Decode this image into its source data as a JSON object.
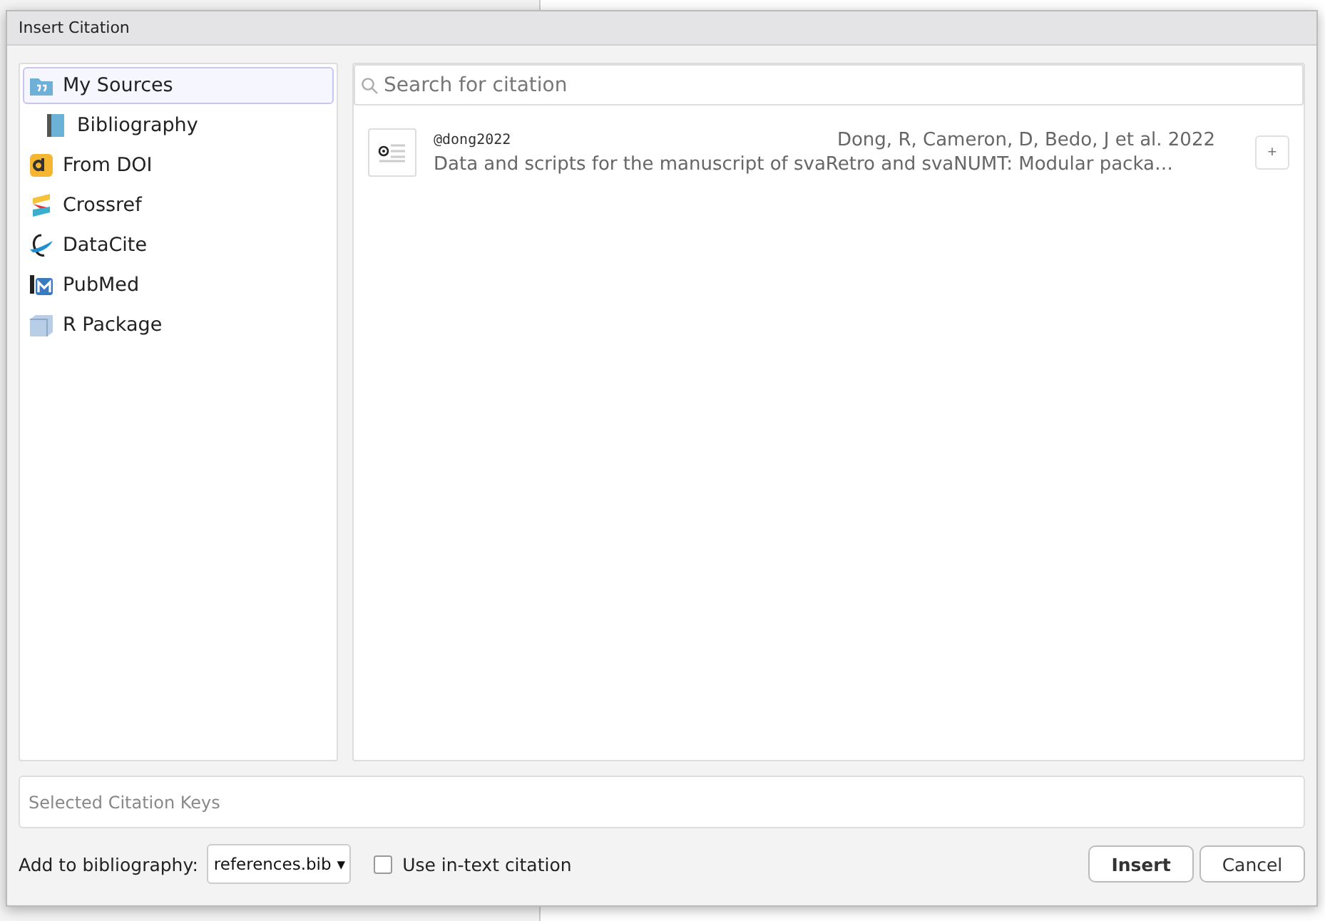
{
  "dialog": {
    "title": "Insert Citation",
    "sources": [
      {
        "label": "My Sources",
        "kind": "folder",
        "selected": true,
        "children": [
          {
            "label": "Bibliography",
            "kind": "book",
            "selected": false
          }
        ]
      },
      {
        "label": "From DOI",
        "kind": "doi",
        "selected": false
      },
      {
        "label": "Crossref",
        "kind": "crossref",
        "selected": false
      },
      {
        "label": "DataCite",
        "kind": "datacite",
        "selected": false
      },
      {
        "label": "PubMed",
        "kind": "pubmed",
        "selected": false
      },
      {
        "label": "R Package",
        "kind": "package",
        "selected": false
      }
    ],
    "search": {
      "placeholder": "Search for citation"
    },
    "results": [
      {
        "key": "@dong2022",
        "authors": "Dong, R, Cameron, D, Bedo, J et al. 2022",
        "title": "Data and scripts for the manuscript of svaRetro and svaNUMT: Modular packa…",
        "add": "+"
      }
    ],
    "keys_field": {
      "placeholder": "Selected Citation Keys"
    },
    "bibliography": {
      "label": "Add to bibliography:",
      "value": "references.bib",
      "caret": "▾"
    },
    "in_text": {
      "label": "Use in-text citation",
      "checked": false
    },
    "buttons": [
      {
        "label": "Insert",
        "kind": "primary"
      },
      {
        "label": "Cancel",
        "kind": "secondary"
      }
    ]
  }
}
